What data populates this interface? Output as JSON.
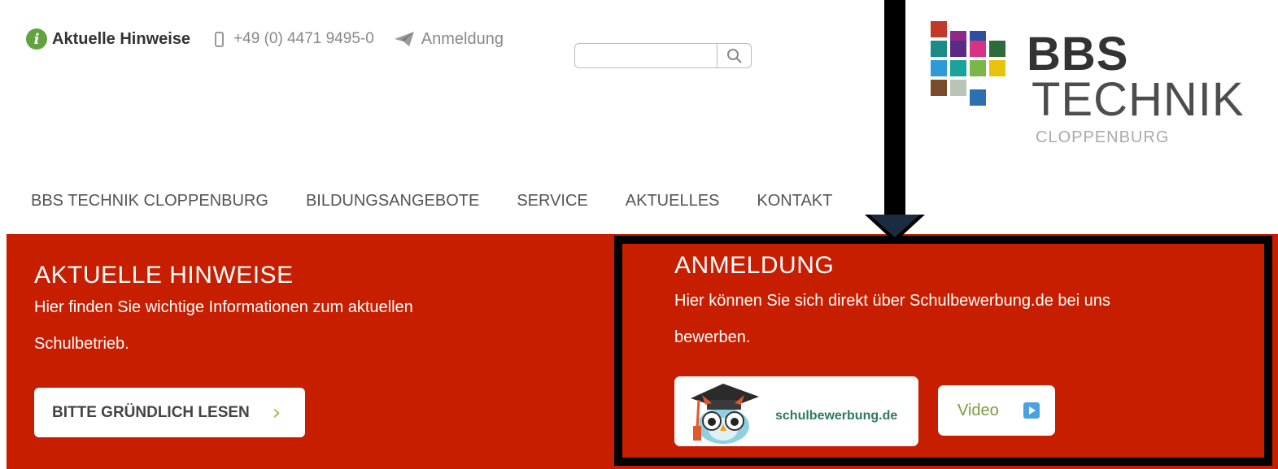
{
  "topbar": {
    "hinweise_label": "Aktuelle Hinweise",
    "phone": "+49 (0) 4471 9495-0",
    "anmeldung_label": "Anmeldung",
    "search_value": ""
  },
  "logo": {
    "line1": "BBS",
    "line2": "TECHNIK",
    "line3": "CLOPPENBURG",
    "colors": [
      "#c0392b",
      "#8e2a8a",
      "#2e4ea3",
      "#1d8a8a",
      "#5b2a86",
      "#d63384",
      "#2d6b3a",
      "#2d9bd8",
      "#1aa39a",
      "#7ab648",
      "#e8c30b",
      "#7a4b2a",
      "#b8c4b8",
      "#2d6fb0"
    ]
  },
  "nav": {
    "items": [
      "BBS TECHNIK CLOPPENBURG",
      "BILDUNGSANGEBOTE",
      "SERVICE",
      "AKTUELLES",
      "KONTAKT"
    ]
  },
  "left_panel": {
    "title": "AKTUELLE HINWEISE",
    "text_line1": "Hier finden Sie wichtige Informationen zum aktuellen",
    "text_line2": "Schulbetrieb.",
    "button_label": "BITTE GRÜNDLICH LESEN",
    "button_chevron": "›"
  },
  "right_panel": {
    "title": "ANMELDUNG",
    "text_line1": "Hier können Sie sich direkt über Schulbewerbung.de bei uns",
    "text_line2": "bewerben.",
    "schulbewerbung_label": "schulbewerbung.de",
    "video_label": "Video"
  },
  "colors": {
    "band_red": "#c81e00",
    "accent_green": "#62a33f",
    "chevron_green": "#8cbf4a",
    "annotation_black": "#000000"
  }
}
